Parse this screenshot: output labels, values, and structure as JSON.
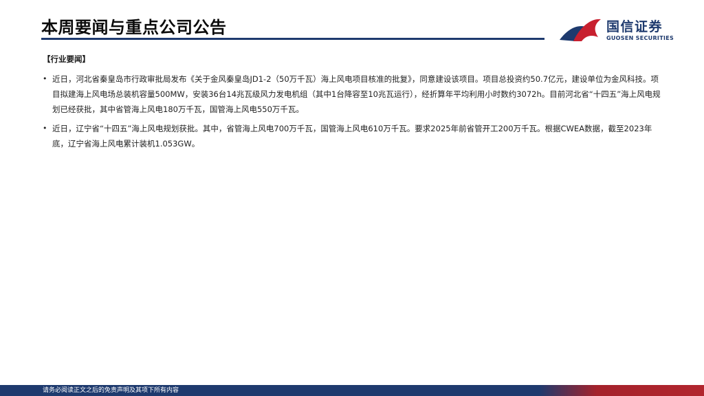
{
  "header": {
    "title": "本周要闻与重点公司公告"
  },
  "logo": {
    "name_cn": "国信证券",
    "name_en": "GUOSEN SECURITIES",
    "colors": {
      "blue": "#1e3a6e",
      "red": "#c8202f"
    }
  },
  "section": {
    "label": "【行业要闻】"
  },
  "news": [
    {
      "text": "近日，河北省秦皇岛市行政审批局发布《关于金风秦皇岛JD1-2（50万千瓦）海上风电项目核准的批复》，同意建设该项目。项目总投资约50.7亿元，建设单位为金风科技。项目拟建海上风电场总装机容量500MW，安装36台14兆瓦级风力发电机组（其中1台降容至10兆瓦运行），经折算年平均利用小时数约3072h。目前河北省“十四五”海上风电规划已经获批，其中省管海上风电180万千瓦，国管海上风电550万千瓦。"
    },
    {
      "text": "近日，辽宁省“十四五”海上风电规划获批。其中，省管海上风电700万千瓦，国管海上风电610万千瓦。要求2025年前省管开工200万千瓦。根据CWEA数据，截至2023年底，辽宁省海上风电累计装机1.053GW。"
    }
  ],
  "footer": {
    "disclaimer": "请务必阅读正文之后的免责声明及其项下所有内容"
  }
}
